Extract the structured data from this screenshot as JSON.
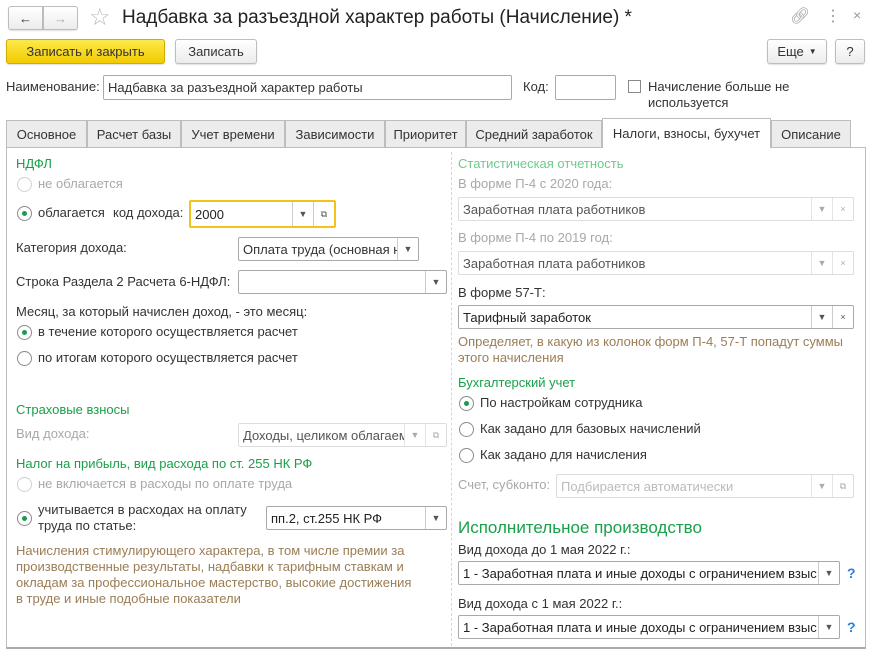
{
  "window": {
    "title": "Надбавка за разъездной характер работы (Начисление) *"
  },
  "toolbar": {
    "save_close": "Записать и закрыть",
    "save": "Записать",
    "more": "Еще",
    "help": "?"
  },
  "header": {
    "name_label": "Наименование:",
    "name_value": "Надбавка за разъездной характер работы",
    "code_label": "Код:",
    "code_value": "",
    "unused_label_1": "Начисление больше не",
    "unused_label_2": "используется",
    "unused_checked": false
  },
  "tabs": [
    {
      "label": "Основное"
    },
    {
      "label": "Расчет базы"
    },
    {
      "label": "Учет времени"
    },
    {
      "label": "Зависимости"
    },
    {
      "label": "Приоритет"
    },
    {
      "label": "Средний заработок"
    },
    {
      "label": "Налоги, взносы, бухучет",
      "active": true
    },
    {
      "label": "Описание"
    }
  ],
  "ndfl": {
    "title": "НДФЛ",
    "not_taxed": "не облагается",
    "taxed": "облагается",
    "code_label": "код дохода:",
    "code_value": "2000",
    "category_label": "Категория дохода:",
    "category_value": "Оплата труда (основная н",
    "row_label": "Строка Раздела 2 Расчета 6-НДФЛ:",
    "row_value": "",
    "month_label": "Месяц, за который начислен доход, - это месяц:",
    "month_opt1": "в течение которого осуществляется расчет",
    "month_opt2": "по итогам которого осуществляется расчет"
  },
  "insurance": {
    "title": "Страховые взносы",
    "income_label": "Вид дохода:",
    "income_value": "Доходы, целиком облагаем"
  },
  "profit_tax": {
    "title": "Налог на прибыль, вид расхода по ст. 255 НК РФ",
    "opt1": "не включается в расходы по оплате труда",
    "opt2_line1": "учитывается в расходах на оплату",
    "opt2_line2": "труда по статье:",
    "article_value": "пп.2, ст.255 НК РФ",
    "note": [
      "Начисления стимулирующего характера, в том числе премии за",
      "производственные результаты, надбавки к тарифным ставкам и",
      "окладам за профессиональное мастерство, высокие достижения",
      "в труде и иные подобные показатели"
    ]
  },
  "stats": {
    "title": "Статистическая отчетность",
    "p4_2020_label": "В форме П-4 с 2020 года:",
    "p4_2020_value": "Заработная плата работников",
    "p4_2019_label": "В форме П-4 по 2019 год:",
    "p4_2019_value": "Заработная плата работников",
    "f57_label": "В форме 57-Т:",
    "f57_value": "Тарифный заработок",
    "note": [
      "Определяет, в какую из колонок форм П-4, 57-Т попадут суммы",
      "этого начисления"
    ]
  },
  "accounting": {
    "title": "Бухгалтерский учет",
    "opt1": "По настройкам сотрудника",
    "opt2": "Как задано для базовых начислений",
    "opt3": "Как задано для начисления",
    "account_label": "Счет, субконто:",
    "account_placeholder": "Подбирается автоматически"
  },
  "enforcement": {
    "title": "Исполнительное производство",
    "before_label": "Вид дохода до 1 мая 2022 г.:",
    "before_value": "1 - Заработная плата и иные доходы с ограничением взыс",
    "after_label": "Вид дохода с 1 мая 2022 г.:",
    "after_value": "1 - Заработная плата и иные доходы с ограничением взыс",
    "help": "?"
  },
  "colors": {
    "accent": "#f2cb00",
    "section": "#19a049",
    "note": "#9b7d55"
  }
}
